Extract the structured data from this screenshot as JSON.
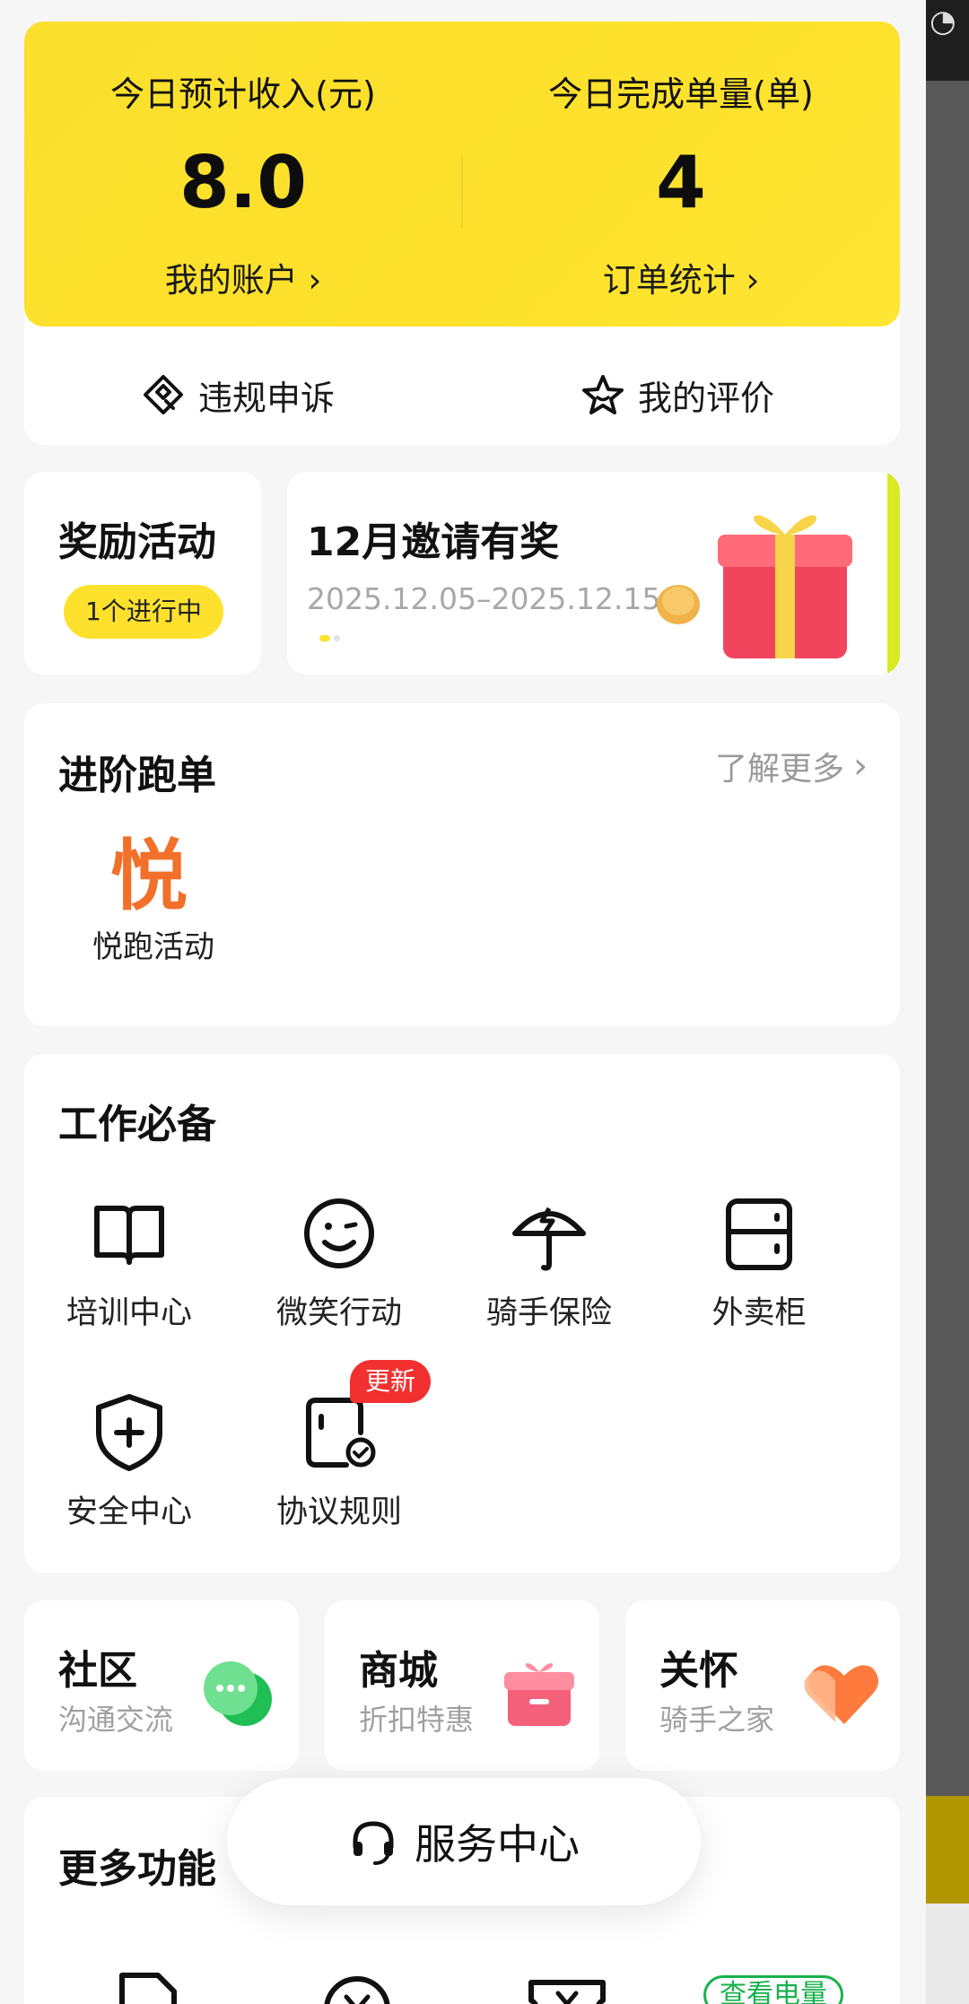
{
  "stats": {
    "income_label": "今日预计收入(元)",
    "income_value": "8.0",
    "account_link": "我的账户 ›",
    "orders_label": "今日完成单量(单)",
    "orders_value": "4",
    "orders_link": "订单统计 ›"
  },
  "quick_actions": {
    "appeal": "违规申诉",
    "review": "我的评价"
  },
  "rewards": {
    "title": "奖励活动",
    "badge": "1个进行中"
  },
  "banner": {
    "title": "12月邀请有奖",
    "date": "2025.12.05–2025.12.15"
  },
  "advanced": {
    "title": "进阶跑单",
    "more": "了解更多",
    "item_glyph": "悦",
    "item_label": "悦跑活动"
  },
  "work": {
    "title": "工作必备",
    "items": [
      {
        "label": "培训中心",
        "icon": "book-icon"
      },
      {
        "label": "微笑行动",
        "icon": "smile-icon"
      },
      {
        "label": "骑手保险",
        "icon": "umbrella-icon"
      },
      {
        "label": "外卖柜",
        "icon": "locker-icon"
      },
      {
        "label": "安全中心",
        "icon": "shield-plus-icon"
      },
      {
        "label": "协议规则",
        "icon": "agreement-icon"
      }
    ],
    "new_badge": "更新"
  },
  "mini_cards": [
    {
      "title": "社区",
      "subtitle": "沟通交流",
      "icon": "chat-icon"
    },
    {
      "title": "商城",
      "subtitle": "折扣特惠",
      "icon": "gift-box-icon"
    },
    {
      "title": "关怀",
      "subtitle": "骑手之家",
      "icon": "heart-icon"
    }
  ],
  "more": {
    "title": "更多功能",
    "power_badge": "查看电量"
  },
  "service": {
    "label": "服务中心"
  },
  "colors": {
    "brand_yellow": "#fde12c",
    "accent_orange": "#f2702a",
    "badge_red": "#f23030",
    "green": "#16b24a"
  }
}
